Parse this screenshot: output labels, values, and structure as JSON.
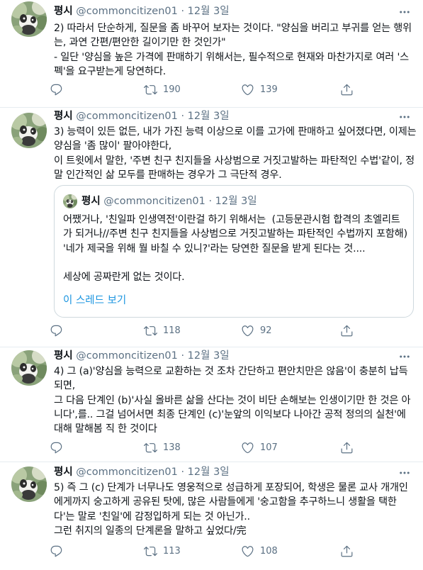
{
  "colors": {
    "accent": "#1b95e0",
    "text": "#0f1419",
    "muted": "#5b7083",
    "border": "#cfd9de"
  },
  "tweets": [
    {
      "name": "평시",
      "handle": "@commoncitizen01",
      "dot": "·",
      "date": "12월 3일",
      "text": "2) 따라서 단순하게, 질문을 좀 바꾸어 보자는 것이다. \"양심을 버리고 부귀를 얻는 행위는, 과연 간편/편안한 길이기만 한 것인가\"\n- 일단 '양심을 높은 가격에 판매하기 위해서는, 필수적으로 현재와 마찬가지로 여러 '스펙'을 요구받는게 당연하다.",
      "replies": "",
      "retweets": "190",
      "likes": "139"
    },
    {
      "name": "평시",
      "handle": "@commoncitizen01",
      "dot": "·",
      "date": "12월 3일",
      "text": "3) 능력이 있든 없든, 내가 가진 능력 이상으로 이를 고가에 판매하고 싶어졌다면, 이제는 양심을 '좀 많이' 팔아야한다,\n이 트윗에서 말한, '주변 친구 친지들을 사상범으로 거짓고발하는 파탄적인 수법'같이, 정말 인간적인 삶 모두를 판매하는 경우가 그 극단적 경우.",
      "quote": {
        "name": "평시",
        "handle": "@commoncitizen01",
        "dot": "·",
        "date": "12월 3일",
        "text": "어쨌거나, '친일파 인생역전'이란걸 하기 위해서는  (고등문관시험 합격의 초엘리트가 되거나//주변 친구 친지들을 사상범으로 거짓고발하는 파탄적인 수법까지 포함해) '네가 제국을 위해 뭘 바칠 수 있니?'라는 당연한 질문을 받게 된다는 것....\n\n세상에 공짜란게 없는 것이다.",
        "link": "이 스레드 보기"
      },
      "replies": "",
      "retweets": "118",
      "likes": "92"
    },
    {
      "name": "평시",
      "handle": "@commoncitizen01",
      "dot": "·",
      "date": "12월 3일",
      "text": "4) 그 (a)'양심을 능력으로 교환하는 것 조차 간단하고 편안치만은 않음'이 충분히 납득되면,\n그 다음 단계인 (b)'사실 올바른 삶을 산다는 것이 비단 손해보는 인생이기만 한 것은 아니다',를.. 그걸 넘어서면 최종 단계인 (c)'눈앞의 이익보다 나아간 공적 정의의 실천'에 대해 말해봄 직 한 것이다",
      "replies": "",
      "retweets": "138",
      "likes": "107"
    },
    {
      "name": "평시",
      "handle": "@commoncitizen01",
      "dot": "·",
      "date": "12월 3일",
      "text": "5) 즉 그 (c) 단계가 너무나도 영웅적으로 성급하게 포장되어, 학생은 물론 교사 개개인에게까지 숭고하게 공유된 탓에, 많은 사람들에게 '숭고함을 추구하느니 생활을 택한다'는 말로 '친일'에 감정입하게 되는 것 아닌가..\n그런 취지의 일종의 단계론을 말하고 싶었다/完",
      "replies": "",
      "retweets": "113",
      "likes": "108"
    }
  ]
}
